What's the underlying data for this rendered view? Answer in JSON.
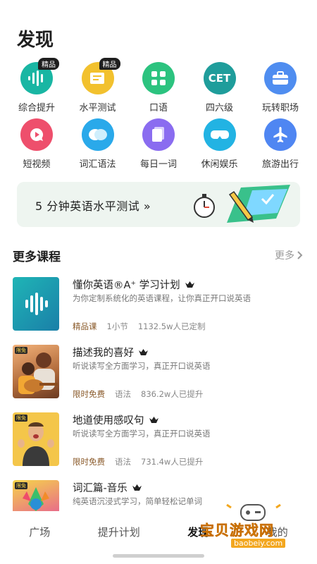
{
  "page": {
    "title": "发现"
  },
  "categories": [
    {
      "label": "综合提升",
      "badge": "精品",
      "icon": "sound-wave-icon",
      "color": "#19b6a3"
    },
    {
      "label": "水平测试",
      "badge": "精品",
      "icon": "test-paper-icon",
      "color": "#f2c12e"
    },
    {
      "label": "口语",
      "icon": "grid-icon",
      "color": "#2cc37f"
    },
    {
      "label": "四六级",
      "icon": "cet-icon",
      "icon_text": "CET",
      "color": "#1f9d9b"
    },
    {
      "label": "玩转职场",
      "icon": "briefcase-icon",
      "color": "#4f8df0"
    },
    {
      "label": "短视频",
      "icon": "video-bubble-icon",
      "color": "#ee4f6c"
    },
    {
      "label": "词汇语法",
      "icon": "chat-bubbles-icon",
      "color": "#2aa9ea"
    },
    {
      "label": "每日一词",
      "icon": "daily-card-icon",
      "color": "#8a6cf0"
    },
    {
      "label": "休闲娱乐",
      "icon": "vr-glasses-icon",
      "color": "#22b3e3"
    },
    {
      "label": "旅游出行",
      "icon": "airplane-icon",
      "color": "#4f86f2"
    }
  ],
  "banner": {
    "text": "5 分钟英语水平测试 »"
  },
  "section": {
    "title": "更多课程",
    "more": "更多"
  },
  "courses": [
    {
      "title": "懂你英语®A⁺ 学习计划",
      "desc": "为你定制系统化的英语课程，让你真正开口说英语",
      "tag": "精品课",
      "type": "1小节",
      "count": "1132.5w人已定制",
      "thumb": "sound-wave-thumb"
    },
    {
      "title": "描述我的喜好",
      "desc": "听说读写全方面学习，真正开口说英语",
      "tag": "限时免费",
      "type": "语法",
      "count": "836.2w人已提升",
      "free": "限免",
      "thumb": "guitar-photo"
    },
    {
      "title": "地道使用感叹句",
      "desc": "听说读写全方面学习，真正开口说英语",
      "tag": "限时免费",
      "type": "语法",
      "count": "731.4w人已提升",
      "free": "限免",
      "thumb": "excited-man-photo"
    },
    {
      "title": "词汇篇-音乐",
      "desc": "纯英语沉浸式学习，简单轻松记单词",
      "free": "限免",
      "thumb": "colorful-art-photo"
    }
  ],
  "tabs": [
    {
      "label": "广场"
    },
    {
      "label": "提升计划"
    },
    {
      "label": "发现"
    },
    {
      "label": "我的"
    }
  ],
  "watermark": {
    "title": "宝贝游戏网",
    "url": "baobeiy.com"
  }
}
